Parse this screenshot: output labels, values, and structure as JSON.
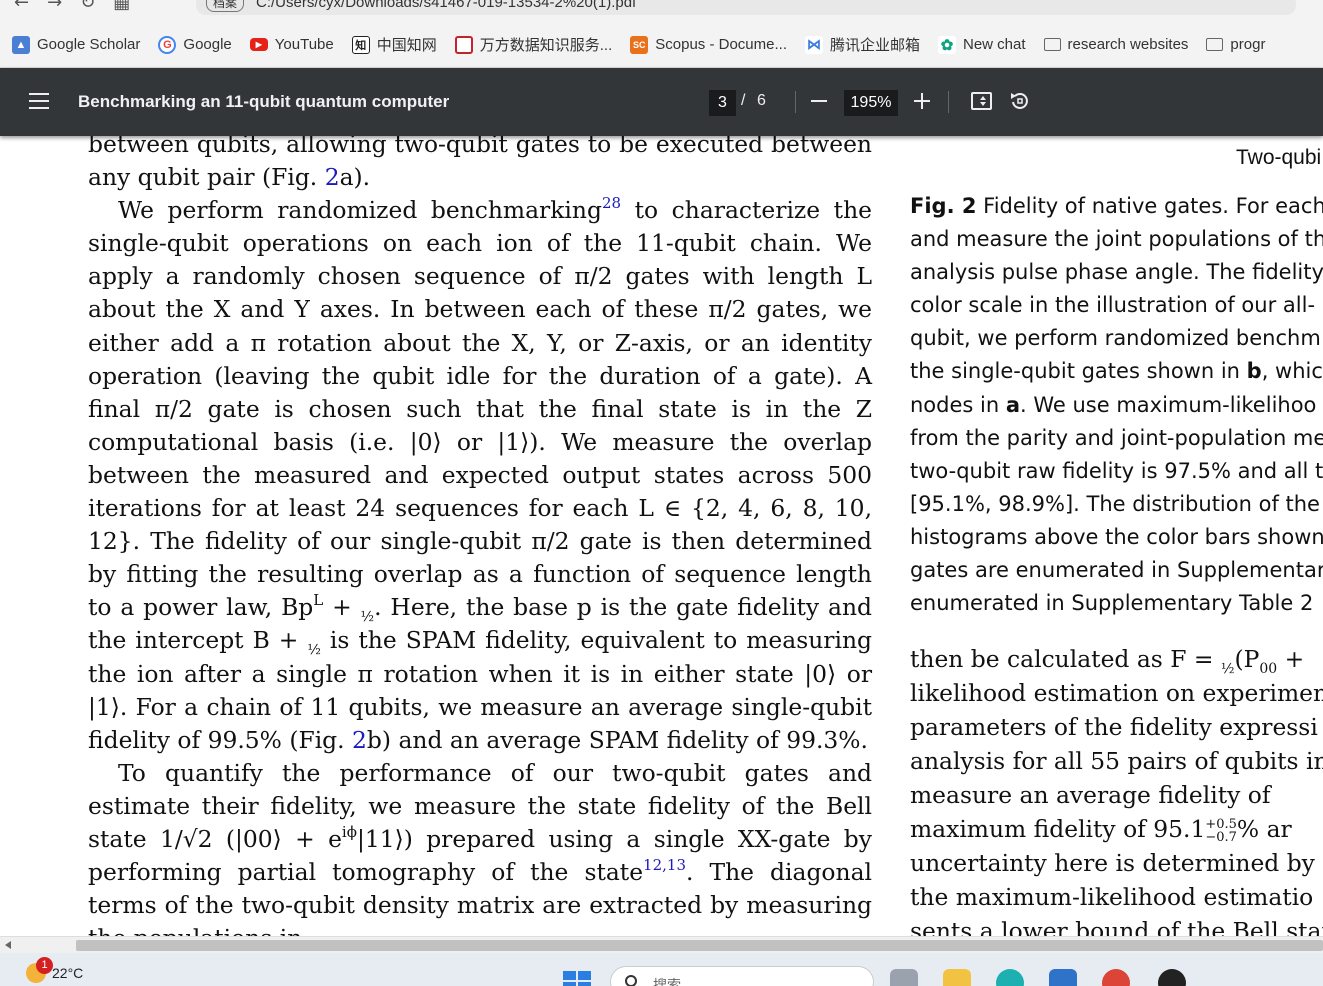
{
  "browser": {
    "address_prefix": "档案",
    "address": "C:/Users/cyx/Downloads/s41467-019-13534-2%20(1).pdf",
    "bookmarks": [
      {
        "label": "Google Scholar",
        "icon": "google-scholar-icon",
        "color": "#4a7fd4"
      },
      {
        "label": "Google",
        "icon": "google-icon",
        "color": "#ea4335"
      },
      {
        "label": "YouTube",
        "icon": "youtube-icon",
        "color": "#e62117"
      },
      {
        "label": "中国知网",
        "icon": "cnki-icon",
        "color": "#222222"
      },
      {
        "label": "万方数据知识服务...",
        "icon": "wanfang-icon",
        "color": "#c8202c"
      },
      {
        "label": "Scopus - Docume...",
        "icon": "scopus-icon",
        "color": "#e9711c"
      },
      {
        "label": "腾讯企业邮箱",
        "icon": "tencent-mail-icon",
        "color": "#3b7de0"
      },
      {
        "label": "New chat",
        "icon": "openai-icon",
        "color": "#10a37f"
      },
      {
        "label": "research websites",
        "icon": "folder-icon",
        "color": "#666666"
      },
      {
        "label": "progr",
        "icon": "folder-icon",
        "color": "#666666"
      }
    ]
  },
  "pdf_toolbar": {
    "title": "Benchmarking an 11-qubit quantum computer",
    "current_page": "3",
    "separator": "/",
    "total_pages": "6",
    "zoom": "195%"
  },
  "document": {
    "left_lines": {
      "l0": "between qubits, allowing two-qubit gates to be executed between",
      "l1a": "any qubit pair (Fig. ",
      "l1b": "2",
      "l1c": "a).",
      "p2a": "We perform randomized benchmarking",
      "p2ref": "28",
      "p2b": " to characterize the single-qubit operations on each ion of the 11-qubit chain. We apply a randomly chosen sequence of π/2 gates with length L about the X and Y axes. In between each of these π/2 gates, we either add a π rotation about the X, Y, or Z-axis, or an identity operation (leaving the qubit idle for the duration of a gate). A final π/2 gate is chosen such that the final state is in the Z computational basis (i.e. |0⟩ or |1⟩). We measure the overlap between the measured and expected output states across 500 iterations for at least 24 sequences for each L ∈ {2, 4, 6, 8, 10, 12}. The fidelity of our single-qubit π/2 gate is then determined by fitting the resulting overlap as a function of sequence length to a power law, Bp",
      "p2sup": "L",
      "p2c": " + ",
      "p2frac": "½",
      "p2d": ". Here, the base p is the gate fidelity and the intercept B + ",
      "p2e": " is the SPAM fidelity, equivalent to measuring the ion after a single π rotation when it is in either state |0⟩ or |1⟩. For a chain of 11 qubits, we measure an average single-qubit fidelity of 99.5% (Fig. ",
      "p2fig": "2",
      "p2f": "b) and an average SPAM fidelity of 99.3%.",
      "p3a": "To quantify the performance of our two-qubit gates and estimate their fidelity, we measure the state fidelity of the Bell state ",
      "p3bell": "1/√2 (|00⟩ + e",
      "p3bellsup": "iϕ",
      "p3bellend": "|11⟩)",
      "p3b": " prepared using a single XX-gate by performing partial tomography of the state",
      "p3ref": "12,13",
      "p3c": ". The diagonal terms of the two-qubit density matrix are extracted by measuring the populations in"
    },
    "figure_top_label": "Two-qubi",
    "caption": {
      "fig_label": "Fig. 2",
      "line1": " Fidelity of native gates. For each",
      "line2": "and measure the joint populations of th",
      "line3": "analysis pulse phase angle. The fidelity",
      "line4": "color scale in the illustration of our all-",
      "line5": "qubit, we perform randomized benchm",
      "line6a": "the single-qubit gates shown in ",
      "line6b": "b",
      "line6c": ", which",
      "line7a": "nodes in ",
      "line7b": "a",
      "line7c": ". We use maximum-likelihoo",
      "line8": "from the parity and joint-population me",
      "line9": "two-qubit raw fidelity is 97.5% and all t",
      "line10": "[95.1%, 98.9%]. The distribution of the",
      "line11": "histograms above the color bars shown",
      "line12": "gates are enumerated in Supplementary",
      "line13": "enumerated in Supplementary Table 2"
    },
    "right_body": {
      "r1a": "then be calculated as F = ",
      "r1b": "½",
      "r1c": "(P",
      "r1sub": "00",
      "r1d": " + ",
      "r2": "likelihood estimation on experiment",
      "r3": "parameters of the fidelity expressi",
      "r4": "analysis for all 55 pairs of qubits in",
      "r5": "measure an average fidelity of",
      "r6a": "maximum fidelity of 95.1",
      "r6sup": "+0.5",
      "r6sub": "−0.7",
      "r6b": "% ar",
      "r7": "uncertainty here is determined by a",
      "r8": "the maximum-likelihood estimatio",
      "r9": "sents a lower bound of the Bell stat"
    }
  },
  "taskbar": {
    "temperature": "22°C",
    "notification_count": "1",
    "search_placeholder": "搜索"
  }
}
